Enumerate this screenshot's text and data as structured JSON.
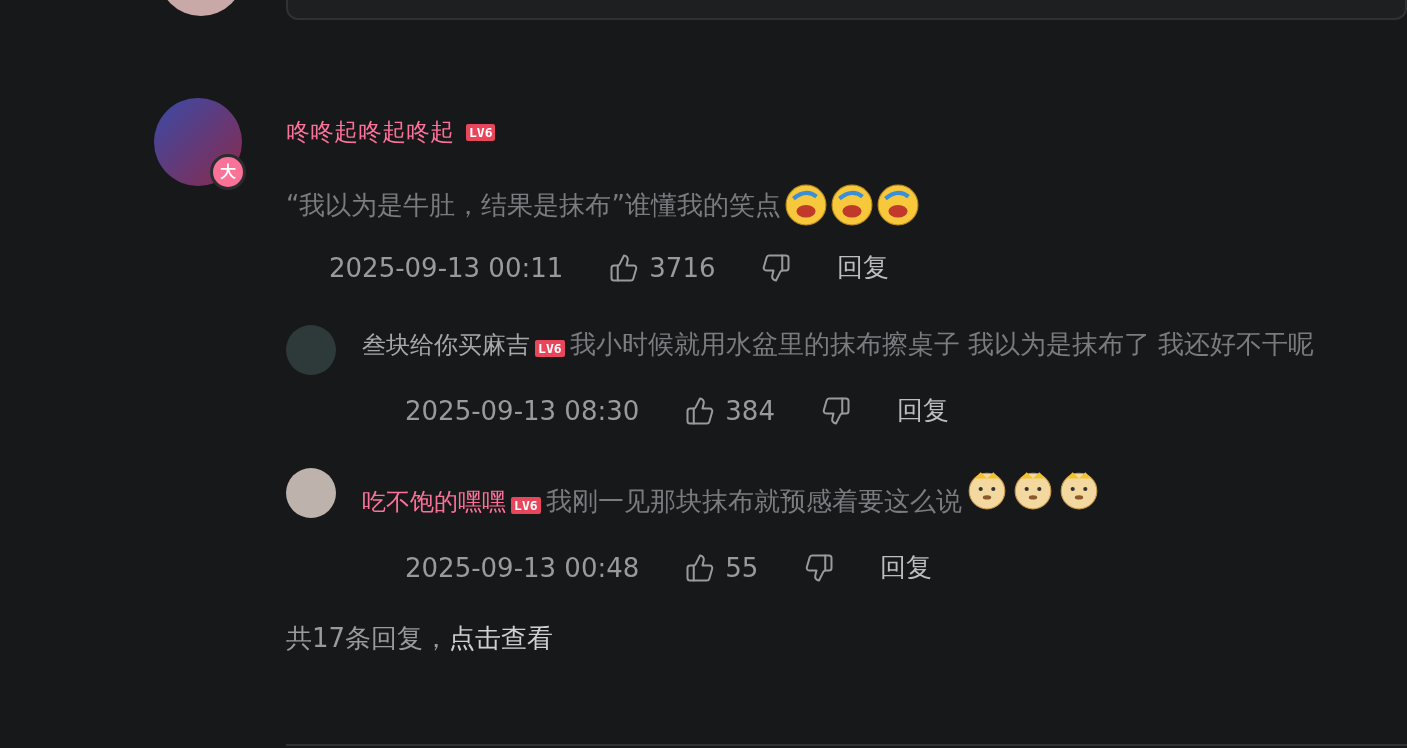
{
  "comments": [
    {
      "author": "咚咚起咚起咚起",
      "level_badge": "LV6",
      "avatar_badge": "大",
      "text": "“我以为是牛肚，结果是抹布”谁懂我的笑点",
      "emojis": [
        {
          "kind": "laugh"
        },
        {
          "kind": "laugh"
        },
        {
          "kind": "laugh"
        }
      ],
      "time": "2025-09-13 00:11",
      "likes": "3716",
      "reply_label": "回复",
      "replies": [
        {
          "author": "叁块给你买麻吉",
          "highlight": false,
          "level_badge": "LV6",
          "text": "我小时候就用水盆里的抹布擦桌子 我以为是抹布了 我还好不干呢",
          "time": "2025-09-13 08:30",
          "likes": "384",
          "reply_label": "回复"
        },
        {
          "author": "吃不饱的嘿嘿",
          "highlight": true,
          "level_badge": "LV6",
          "text": "我刚一见那块抹布就预感着要这么说",
          "emojis": [
            {
              "kind": "doge"
            },
            {
              "kind": "doge"
            },
            {
              "kind": "doge"
            }
          ],
          "time": "2025-09-13 00:48",
          "likes": "55",
          "reply_label": "回复"
        }
      ],
      "reply_summary": "共17条回复，",
      "reply_link": "点击查看"
    }
  ]
}
